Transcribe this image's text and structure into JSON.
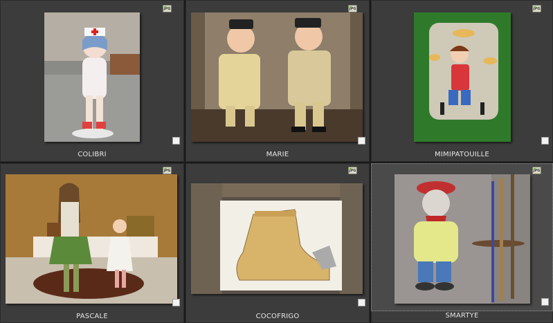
{
  "items": [
    {
      "label": "COLIBRI",
      "badge": "JPG",
      "selected": false,
      "icon": "photo-nurse-figurine"
    },
    {
      "label": "MARIE",
      "badge": "JPG",
      "selected": false,
      "icon": "photo-gendarme-figurines"
    },
    {
      "label": "MIMIPATOUILLE",
      "badge": "JPG",
      "selected": false,
      "icon": "photo-baker-coat-hook"
    },
    {
      "label": "PASCALE",
      "badge": "JPG",
      "selected": false,
      "icon": "photo-girls-figurines"
    },
    {
      "label": "COCOFRIGO",
      "badge": "JPG",
      "selected": false,
      "icon": "photo-boot-painting"
    },
    {
      "label": "SMARTYE",
      "badge": "JPG",
      "selected": true,
      "icon": "photo-painter-figurine"
    }
  ],
  "colors": {
    "cell_bg": "#3c3c3c",
    "selected_bg": "#4a4a4a",
    "label": "#e6e6e6"
  }
}
